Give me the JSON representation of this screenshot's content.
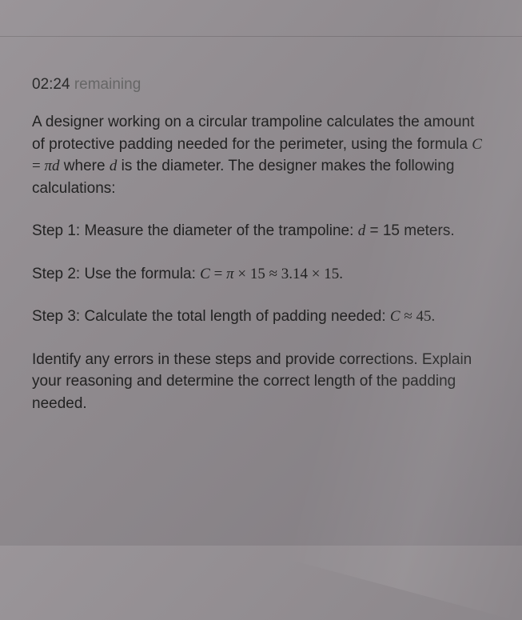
{
  "timer": {
    "time": "02:24",
    "label": "remaining"
  },
  "problem": {
    "intro_part1": "A designer working on a circular trampoline calculates the amount of protective padding needed for the perimeter, using the formula ",
    "formula_C": "C",
    "formula_eq": " = ",
    "formula_pi": "π",
    "formula_d": "d",
    "intro_part2": " where ",
    "formula_d2": "d",
    "intro_part3": " is the diameter. The designer makes the following calculations:"
  },
  "steps": {
    "step1_label": "Step 1: ",
    "step1_text": "Measure the diameter of the trampoline: ",
    "step1_var": "d",
    "step1_val": " = 15 meters.",
    "step2_label": "Step 2: ",
    "step2_text": "Use the formula: ",
    "step2_C": "C",
    "step2_eq1": " = ",
    "step2_pi": "π",
    "step2_mult1": " × 15  ≈ 3.14 × 15.",
    "step3_label": "Step 3: ",
    "step3_text": "Calculate the total length of padding needed: ",
    "step3_C": "C",
    "step3_val": " ≈ 45."
  },
  "question": {
    "text": "Identify any errors in these steps and provide corrections. Explain your reasoning and determine the correct length of the padding needed."
  }
}
